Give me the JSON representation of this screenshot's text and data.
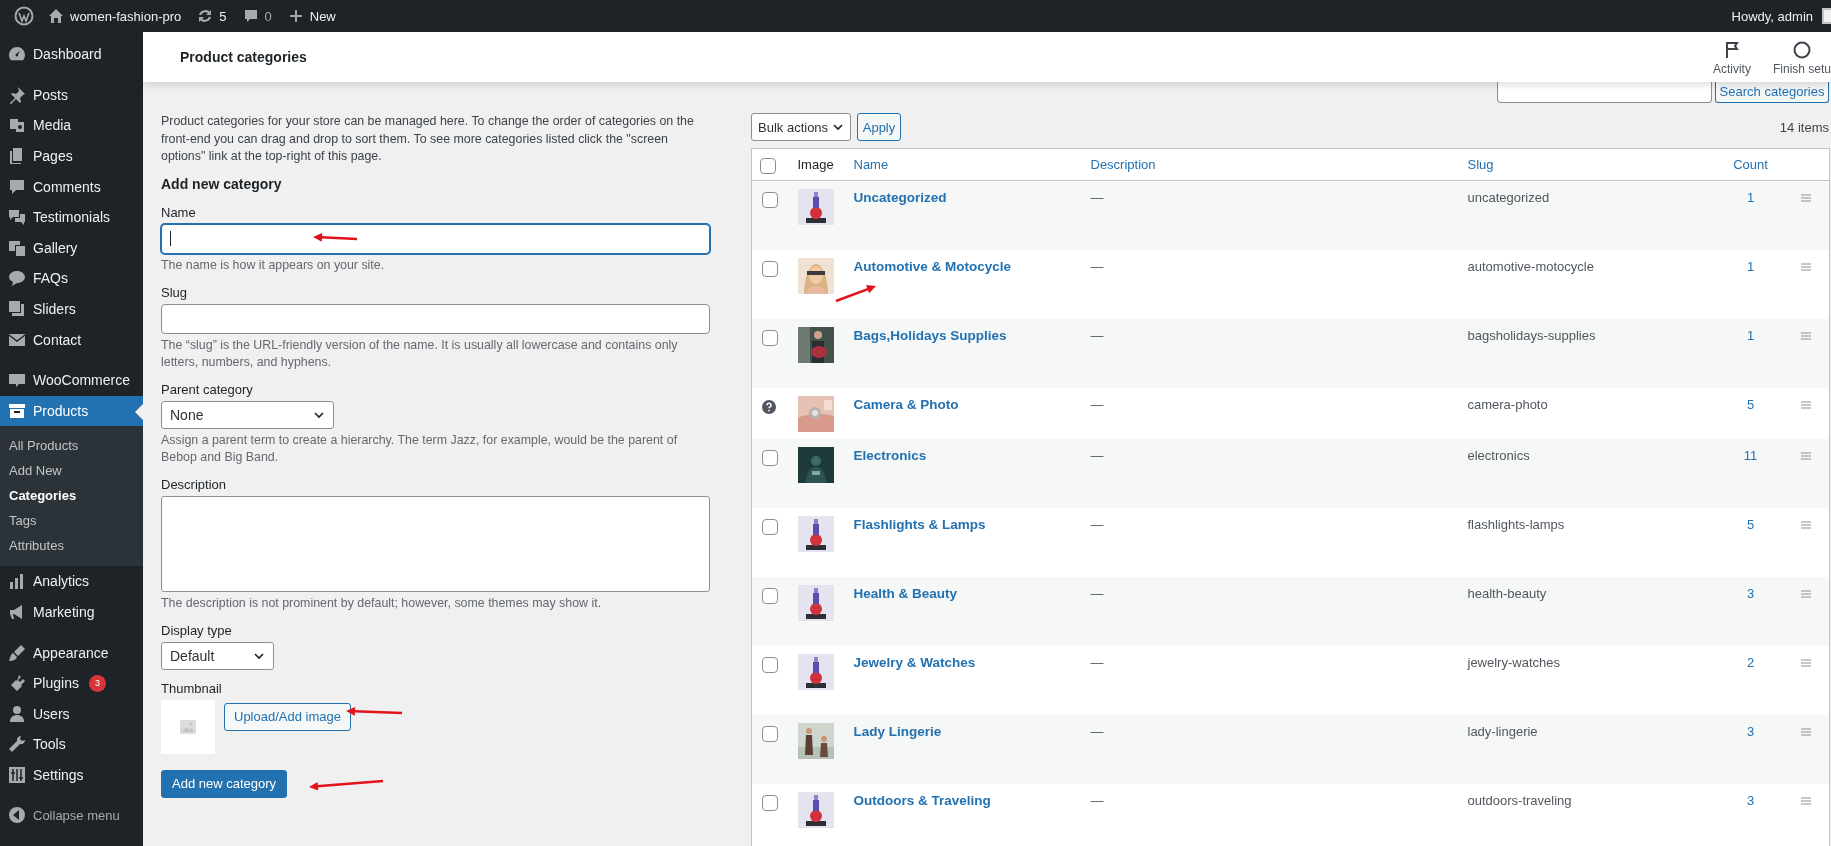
{
  "admin_bar": {
    "site": "women-fashion-pro",
    "updates": "5",
    "comments": "0",
    "new": "New",
    "greeting": "Howdy, admin"
  },
  "sidebar": {
    "groups": [
      {
        "items": [
          {
            "label": "Dashboard",
            "selected": false
          }
        ]
      },
      {
        "items": [
          {
            "label": "Posts",
            "selected": false
          },
          {
            "label": "Media",
            "selected": false
          },
          {
            "label": "Pages",
            "selected": false
          },
          {
            "label": "Comments",
            "selected": false
          },
          {
            "label": "Testimonials",
            "selected": false
          },
          {
            "label": "Gallery",
            "selected": false
          },
          {
            "label": "FAQs",
            "selected": false
          },
          {
            "label": "Sliders",
            "selected": false
          },
          {
            "label": "Contact",
            "selected": false
          }
        ]
      },
      {
        "items": [
          {
            "label": "WooCommerce",
            "selected": false
          },
          {
            "label": "Products",
            "selected": true,
            "children": [
              {
                "label": "All Products",
                "selected": false
              },
              {
                "label": "Add New",
                "selected": false
              },
              {
                "label": "Categories",
                "selected": true
              },
              {
                "label": "Tags",
                "selected": false
              },
              {
                "label": "Attributes",
                "selected": false
              }
            ]
          },
          {
            "label": "Analytics",
            "selected": false
          },
          {
            "label": "Marketing",
            "selected": false
          }
        ]
      },
      {
        "items": [
          {
            "label": "Appearance",
            "selected": false
          },
          {
            "label": "Plugins",
            "selected": false,
            "badge": "3"
          },
          {
            "label": "Users",
            "selected": false
          },
          {
            "label": "Tools",
            "selected": false
          },
          {
            "label": "Settings",
            "selected": false
          }
        ]
      }
    ],
    "collapse": "Collapse menu"
  },
  "header": {
    "title": "Product categories",
    "actions": [
      {
        "label": "Activity"
      },
      {
        "label": "Finish setu"
      }
    ]
  },
  "intro": "Product categories for your store can be managed here. To change the order of categories on the front-end you can drag and drop to sort them. To see more categories listed click the \"screen options\" link at the top-right of this page.",
  "form": {
    "heading": "Add new category",
    "fields": [
      {
        "kind": "text",
        "label": "Name",
        "focused": true,
        "annotated": true,
        "help": "The name is how it appears on your site."
      },
      {
        "kind": "text",
        "label": "Slug",
        "focused": false,
        "annotated": false,
        "help": "The “slug” is the URL-friendly version of the name. It is usually all lowercase and contains only letters, numbers, and hyphens."
      },
      {
        "kind": "select",
        "label": "Parent category",
        "value": "None",
        "help": "Assign a parent term to create a hierarchy. The term Jazz, for example, would be the parent of Bebop and Big Band."
      },
      {
        "kind": "textarea",
        "label": "Description",
        "help": "The description is not prominent by default; however, some themes may show it."
      },
      {
        "kind": "select",
        "label": "Display type",
        "value": "Default"
      },
      {
        "kind": "thumbnail",
        "label": "Thumbnail",
        "button": "Upload/Add image",
        "annotated": true
      }
    ],
    "submit": {
      "label": "Add new category",
      "annotated": true
    }
  },
  "search": {
    "button": "Search categories"
  },
  "bulk": {
    "value": "Bulk actions",
    "apply": "Apply",
    "count": "14 items"
  },
  "table": {
    "select_all_checked": false,
    "columns": [
      {
        "label": "Image",
        "sortable": false
      },
      {
        "label": "Name",
        "sortable": true
      },
      {
        "label": "Description",
        "sortable": true
      },
      {
        "label": "Slug",
        "sortable": true
      },
      {
        "label": "Count",
        "sortable": true
      }
    ],
    "rows": [
      {
        "kind": "checkbox",
        "checked": false,
        "annotated": false,
        "name": "Uncategorized",
        "description": "—",
        "slug": "uncategorized",
        "count": "1"
      },
      {
        "kind": "checkbox",
        "checked": false,
        "annotated": true,
        "name": "Automotive & Motocycle",
        "description": "—",
        "slug": "automotive-motocycle",
        "count": "1"
      },
      {
        "kind": "checkbox",
        "checked": false,
        "annotated": false,
        "name": "Bags,Holidays Supplies",
        "description": "—",
        "slug": "bagsholidays-supplies",
        "count": "1"
      },
      {
        "kind": "help",
        "annotated": false,
        "name": "Camera & Photo",
        "description": "—",
        "slug": "camera-photo",
        "count": "5"
      },
      {
        "kind": "checkbox",
        "checked": false,
        "annotated": false,
        "name": "Electronics",
        "description": "—",
        "slug": "electronics",
        "count": "11"
      },
      {
        "kind": "checkbox",
        "checked": false,
        "annotated": false,
        "name": "Flashlights & Lamps",
        "description": "—",
        "slug": "flashlights-lamps",
        "count": "5"
      },
      {
        "kind": "checkbox",
        "checked": false,
        "annotated": false,
        "name": "Health & Beauty",
        "description": "—",
        "slug": "health-beauty",
        "count": "3"
      },
      {
        "kind": "checkbox",
        "checked": false,
        "annotated": false,
        "name": "Jewelry & Watches",
        "description": "—",
        "slug": "jewelry-watches",
        "count": "2"
      },
      {
        "kind": "checkbox",
        "checked": false,
        "annotated": false,
        "name": "Lady Lingerie",
        "description": "—",
        "slug": "lady-lingerie",
        "count": "3"
      },
      {
        "kind": "checkbox",
        "checked": false,
        "annotated": false,
        "name": "Outdoors & Traveling",
        "description": "—",
        "slug": "outdoors-traveling",
        "count": "3"
      }
    ]
  }
}
